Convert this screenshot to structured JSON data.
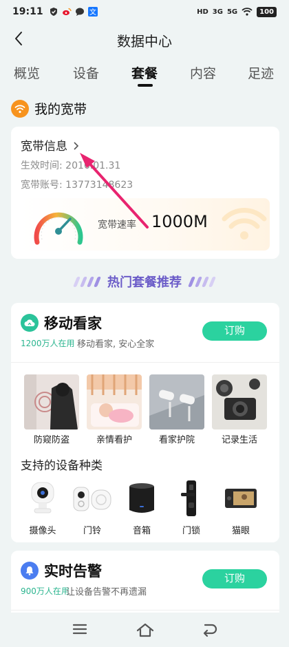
{
  "status_bar": {
    "time": "19:11",
    "net1": "HD",
    "net2": "3G",
    "net3": "5G",
    "battery": "100"
  },
  "header": {
    "title": "数据中心"
  },
  "tabs": [
    {
      "label": "概览",
      "active": false
    },
    {
      "label": "设备",
      "active": false
    },
    {
      "label": "套餐",
      "active": true
    },
    {
      "label": "内容",
      "active": false
    },
    {
      "label": "足迹",
      "active": false
    }
  ],
  "broadband": {
    "section_title": "我的宽带",
    "info_title": "宽带信息",
    "effective_time": "生效时间: 2016.01.31",
    "account": "宽带账号: 13773148623",
    "speed_label": "宽带速率",
    "speed_value": "1000M"
  },
  "promo": {
    "title": "热门套餐推荐"
  },
  "package_home": {
    "name": "移动看家",
    "users": "1200万人在用",
    "desc": "移动看家, 安心全家",
    "buy_label": "订购",
    "features": [
      {
        "label": "防窥防盗",
        "icon": "security-camera-scene"
      },
      {
        "label": "亲情看护",
        "icon": "baby-sleeping-scene"
      },
      {
        "label": "看家护院",
        "icon": "yard-camera-scene"
      },
      {
        "label": "记录生活",
        "icon": "camera-scene"
      }
    ],
    "devices_title": "支持的设备种类",
    "devices": [
      {
        "label": "摄像头",
        "icon": "webcam-icon"
      },
      {
        "label": "门铃",
        "icon": "doorbell-icon"
      },
      {
        "label": "音箱",
        "icon": "speaker-icon"
      },
      {
        "label": "门锁",
        "icon": "door-lock-icon"
      },
      {
        "label": "猫眼",
        "icon": "peephole-icon"
      }
    ]
  },
  "package_alarm": {
    "name": "实时告警",
    "users": "900万人在用",
    "desc": "让设备告警不再遗漏",
    "buy_label": "订购"
  },
  "colors": {
    "accent_green": "#2bd29f",
    "accent_orange": "#f7931e",
    "promo_purple": "#6b5cc8",
    "annotation_pink": "#e8246f"
  }
}
